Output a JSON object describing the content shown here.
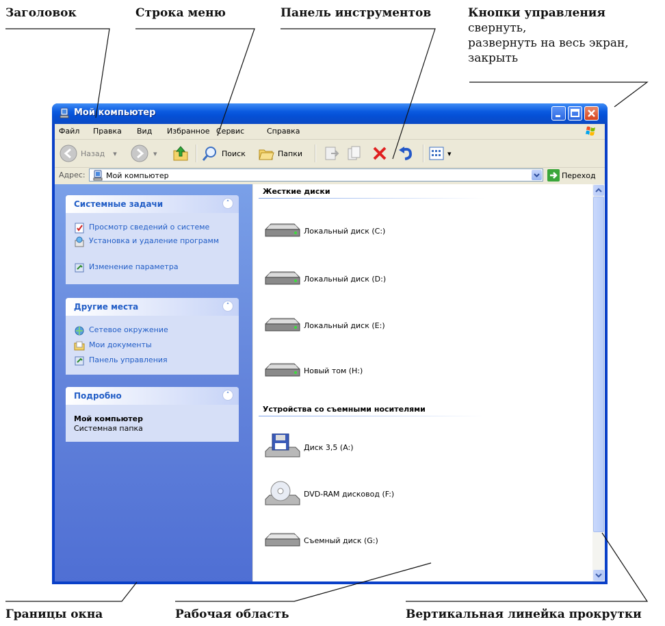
{
  "annotations": {
    "title": "Заголовок",
    "menu_bar": "Строка меню",
    "toolbar": "Панель инструментов",
    "controls": "Кнопки управления",
    "controls_line1": "свернуть,",
    "controls_line2": "развернуть на весь экран,",
    "controls_line3": "закрыть",
    "borders": "Границы окна",
    "work_area": "Рабочая область",
    "vscroll": "Вертикальная линейка прокрутки"
  },
  "window": {
    "title": "Мой компьютер",
    "title_bar_color": "#0a5ae0",
    "close_color": "#d8421c"
  },
  "menu": {
    "items": [
      "Файл",
      "Правка",
      "Вид",
      "Избранное",
      "Сервис",
      "Справка"
    ]
  },
  "toolbar": {
    "back": "Назад",
    "search": "Поиск",
    "folders": "Папки"
  },
  "address": {
    "label": "Адрес:",
    "value": "Мой компьютер",
    "go": "Переход"
  },
  "tasks": {
    "system": {
      "title": "Системные задачи",
      "items": [
        "Просмотр сведений о системе",
        "Установка и удаление программ",
        "Изменение параметра"
      ]
    },
    "other": {
      "title": "Другие места",
      "items": [
        "Сетевое окружение",
        "Мои документы",
        "Панель управления"
      ]
    },
    "details": {
      "title": "Подробно",
      "name": "Мой компьютер",
      "desc": "Системная папка"
    }
  },
  "groups": {
    "hard_disks": {
      "title": "Жесткие диски",
      "items": [
        "Локальный диск (C:)",
        "Локальный диск (D:)",
        "Локальный диск (E:)",
        "Новый том (H:)"
      ]
    },
    "removable": {
      "title": "Устройства со съемными носителями",
      "items": [
        "Диск 3,5 (A:)",
        "DVD-RAM дисковод (F:)",
        "Съемный диск (G:)"
      ]
    }
  }
}
